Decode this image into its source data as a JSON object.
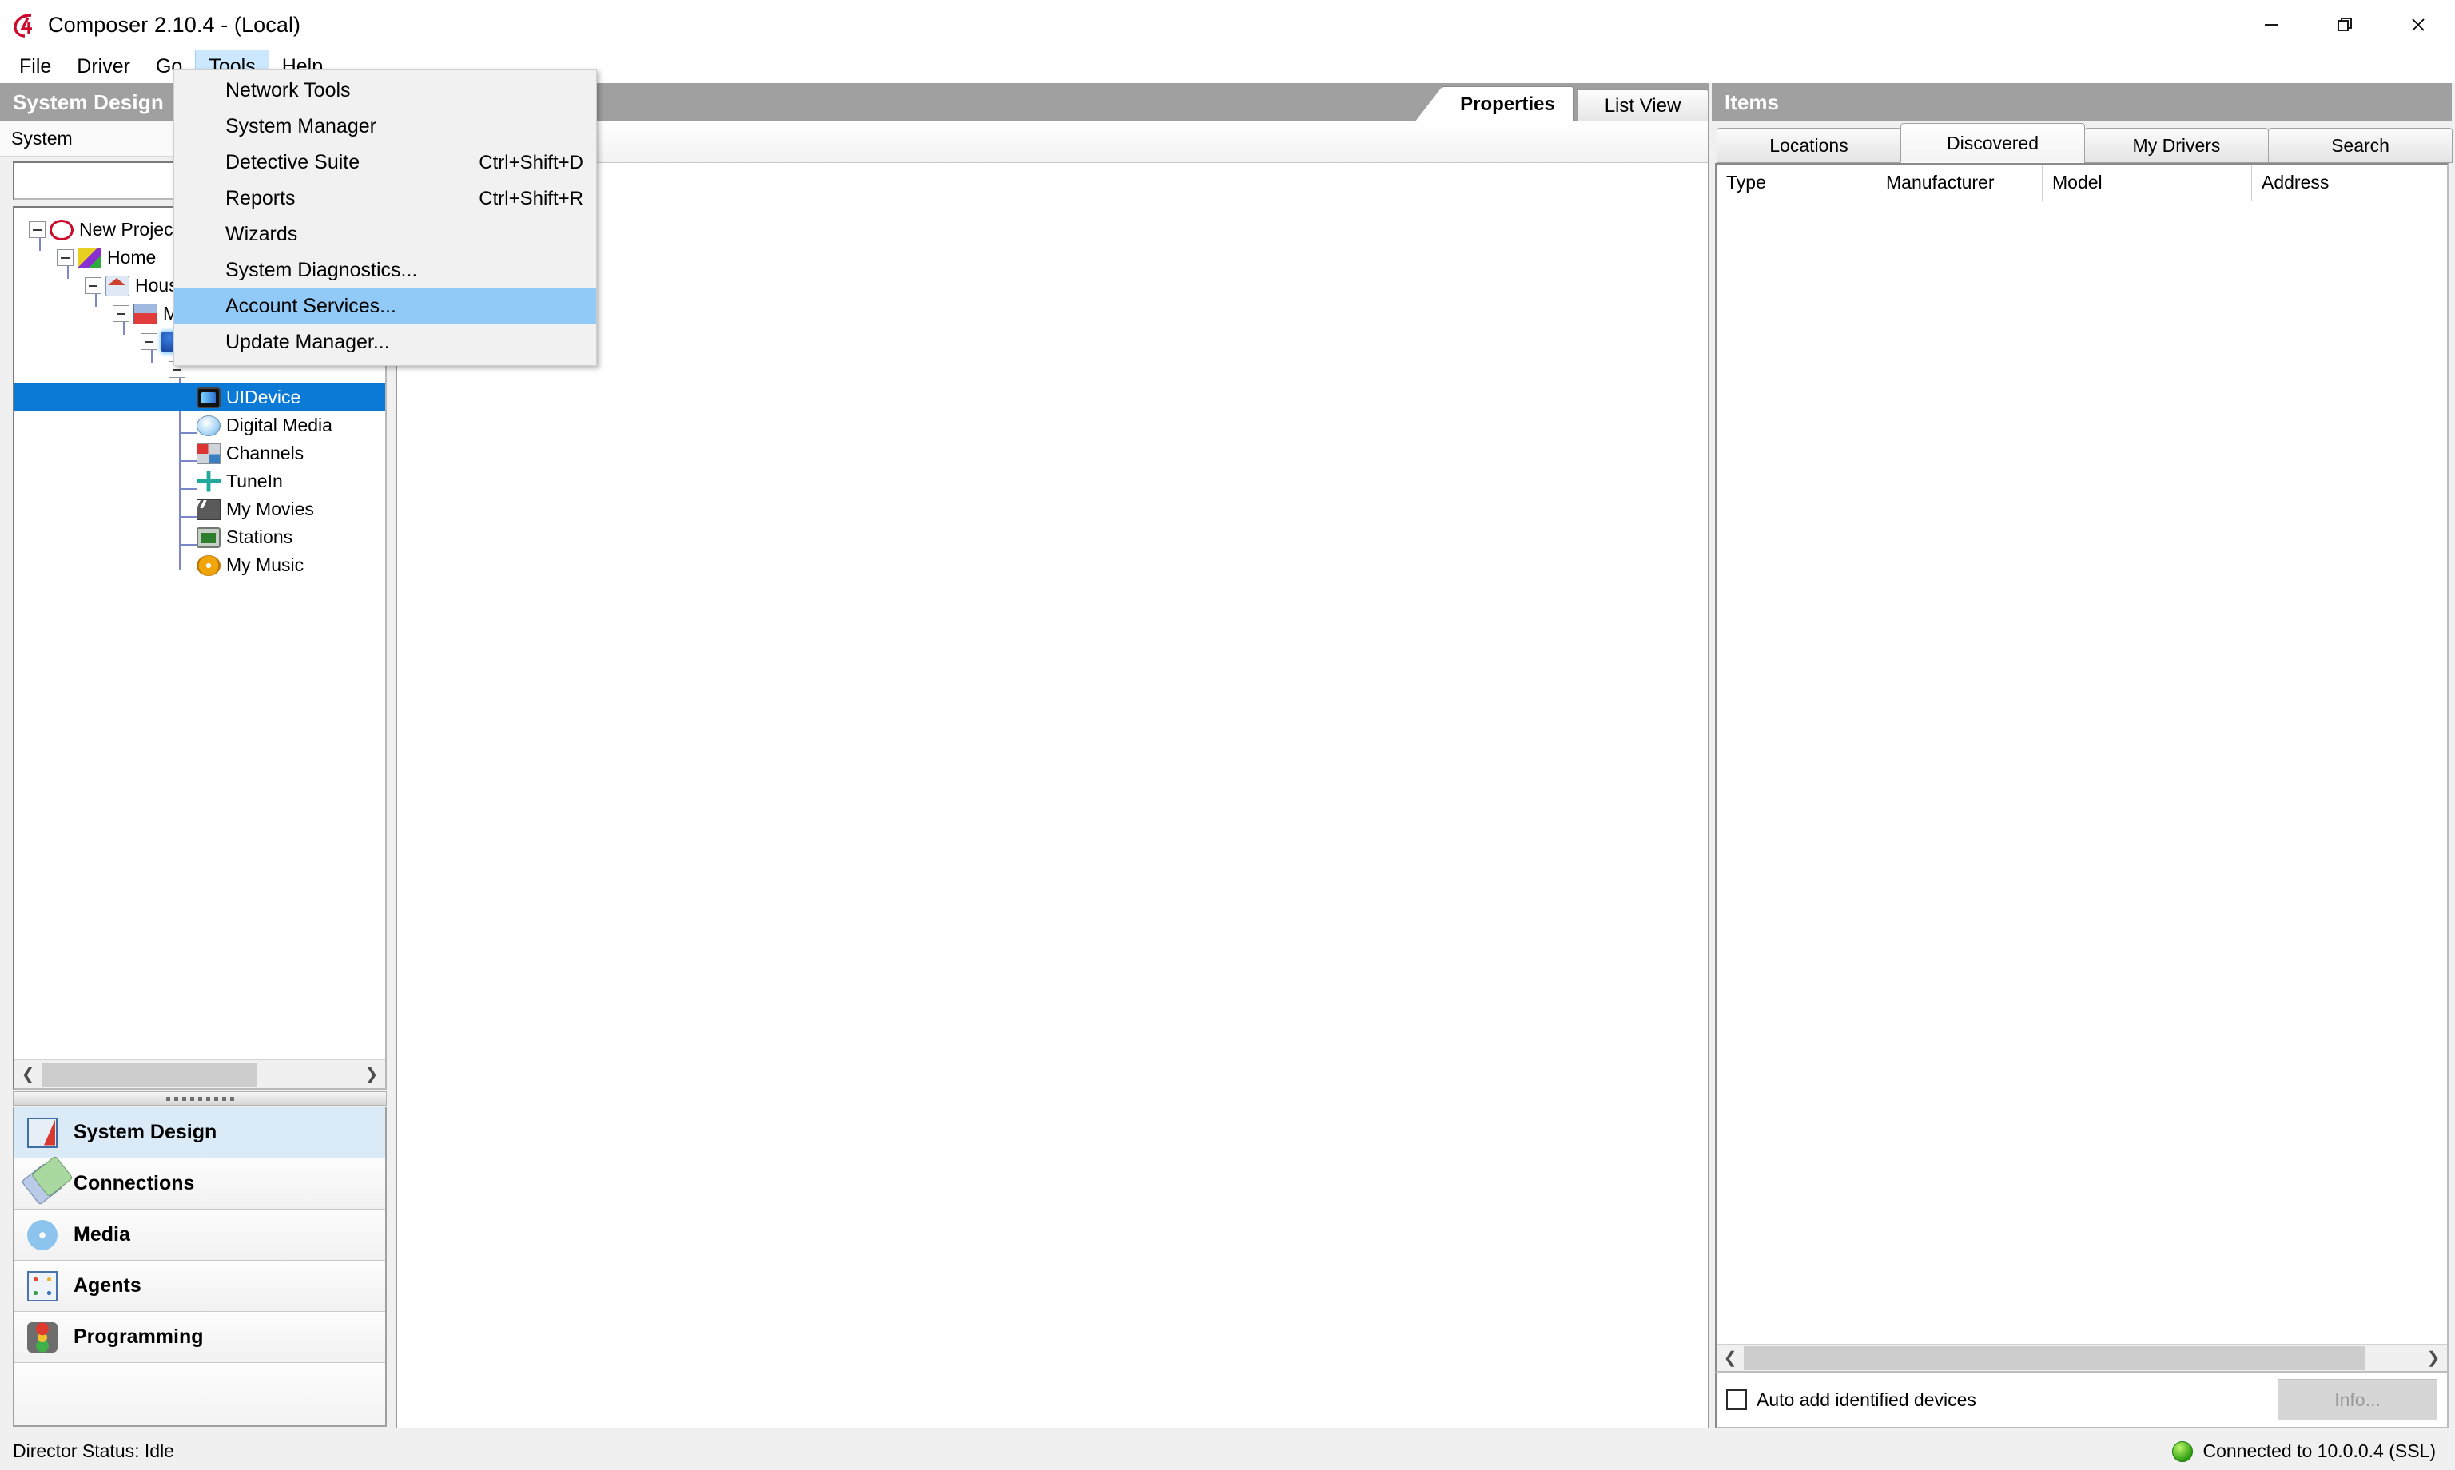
{
  "window": {
    "title": "Composer 2.10.4 - (Local)",
    "logo_icon": "composer-c4-logo-icon",
    "controls": {
      "minimize": "minimize-icon",
      "restore": "restore-icon",
      "close": "close-icon"
    }
  },
  "menubar": {
    "items": [
      {
        "label": "File",
        "open": false
      },
      {
        "label": "Driver",
        "open": false
      },
      {
        "label": "Go",
        "open": false
      },
      {
        "label": "Tools",
        "open": true
      },
      {
        "label": "Help",
        "open": false
      }
    ]
  },
  "tools_menu": {
    "items": [
      {
        "label": "Network Tools",
        "shortcut": "",
        "highlighted": false
      },
      {
        "label": "System Manager",
        "shortcut": "",
        "highlighted": false
      },
      {
        "label": "Detective Suite",
        "shortcut": "Ctrl+Shift+D",
        "highlighted": false
      },
      {
        "label": "Reports",
        "shortcut": "Ctrl+Shift+R",
        "highlighted": false
      },
      {
        "label": "Wizards",
        "shortcut": "",
        "highlighted": false
      },
      {
        "label": "System Diagnostics...",
        "shortcut": "",
        "highlighted": false
      },
      {
        "label": "Account Services...",
        "shortcut": "",
        "highlighted": true
      },
      {
        "label": "Update Manager...",
        "shortcut": "",
        "highlighted": false
      }
    ]
  },
  "left_panel": {
    "caption": "System Design",
    "system_label": "System",
    "system_input_value": "",
    "tree": [
      {
        "label": "New Project",
        "depth": 0,
        "icon": "c4-project-icon",
        "expander": true,
        "selected": false
      },
      {
        "label": "Home",
        "depth": 1,
        "icon": "home-icon",
        "expander": true,
        "selected": false
      },
      {
        "label": "House",
        "depth": 2,
        "icon": "house-icon",
        "expander": true,
        "selected": false
      },
      {
        "label": "Ma",
        "depth": 3,
        "icon": "room-icon",
        "expander": true,
        "selected": false
      },
      {
        "label": "",
        "depth": 4,
        "icon": "blue-cube-icon",
        "expander": true,
        "selected": false
      },
      {
        "label": "",
        "depth": 5,
        "icon": "none",
        "expander": true,
        "selected": false
      },
      {
        "label": "UIDevice",
        "depth": 6,
        "icon": "uidevice-icon",
        "expander": false,
        "selected": true
      },
      {
        "label": "Digital Media",
        "depth": 5,
        "icon": "digital-media-icon",
        "expander": false,
        "selected": false
      },
      {
        "label": "Channels",
        "depth": 5,
        "icon": "channels-icon",
        "expander": false,
        "selected": false
      },
      {
        "label": "TuneIn",
        "depth": 5,
        "icon": "tunein-icon",
        "expander": false,
        "selected": false
      },
      {
        "label": "My Movies",
        "depth": 5,
        "icon": "my-movies-icon",
        "expander": false,
        "selected": false
      },
      {
        "label": "Stations",
        "depth": 5,
        "icon": "stations-icon",
        "expander": false,
        "selected": false
      },
      {
        "label": "My Music",
        "depth": 5,
        "icon": "my-music-icon",
        "expander": false,
        "selected": false
      }
    ],
    "nav_items": [
      {
        "label": "System Design",
        "icon": "system-design-icon",
        "active": true
      },
      {
        "label": "Connections",
        "icon": "connections-icon",
        "active": false
      },
      {
        "label": "Media",
        "icon": "media-icon",
        "active": false
      },
      {
        "label": "Agents",
        "icon": "agents-icon",
        "active": false
      },
      {
        "label": "Programming",
        "icon": "programming-icon",
        "active": false
      }
    ]
  },
  "center_panel": {
    "tabs": [
      {
        "label": "Properties",
        "active": true
      },
      {
        "label": "List View",
        "active": false
      }
    ]
  },
  "right_panel": {
    "caption": "Items",
    "tabs": [
      {
        "label": "Locations",
        "active": false
      },
      {
        "label": "Discovered",
        "active": true
      },
      {
        "label": "My Drivers",
        "active": false
      },
      {
        "label": "Search",
        "active": false
      }
    ],
    "columns": [
      "Type",
      "Manufacturer",
      "Model",
      "Address"
    ],
    "rows": [],
    "auto_add_label": "Auto add identified devices",
    "auto_add_checked": false,
    "info_button_label": "Info...",
    "info_button_enabled": false
  },
  "status_bar": {
    "director_status": "Director Status: Idle",
    "connection": "Connected to 10.0.0.4 (SSL)",
    "connection_led": "green-led-icon"
  },
  "colors": {
    "caption_gray": "#a0a0a0",
    "selection_blue": "#0a7ad6",
    "menu_highlight": "#91c9f7",
    "menubar_open": "#cce8ff",
    "nav_active": "#dbeaf7",
    "led_green": "#2e9e10"
  }
}
